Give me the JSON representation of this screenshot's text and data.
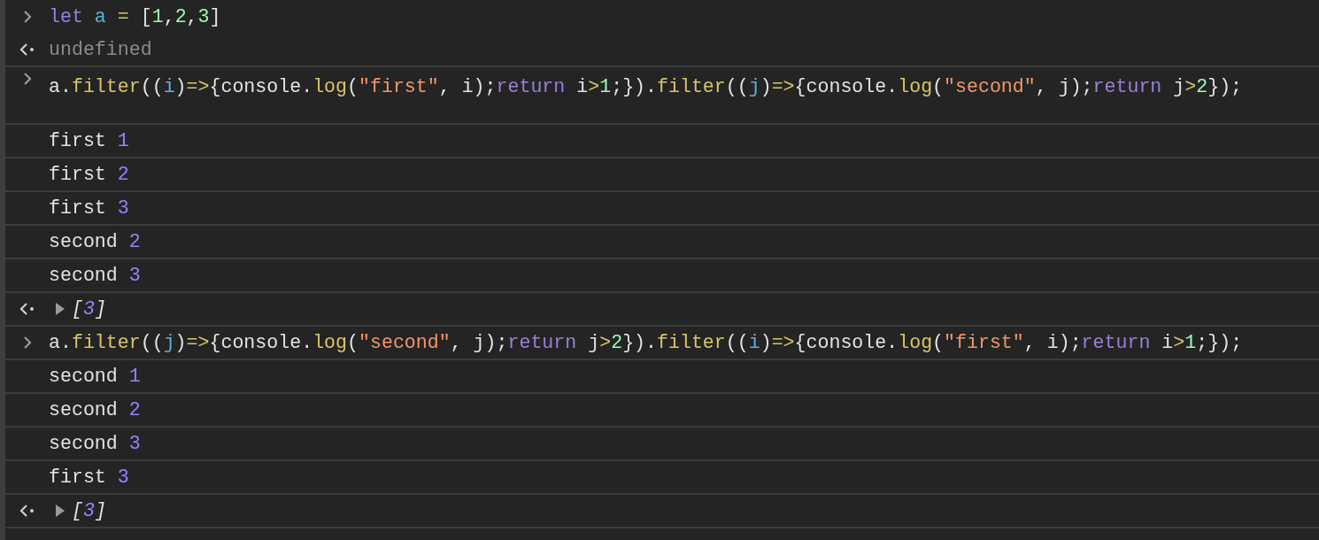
{
  "console": [
    {
      "kind": "input",
      "code": "let a = [1,2,3]"
    },
    {
      "kind": "result",
      "text": "undefined"
    },
    {
      "kind": "input",
      "tall": true,
      "code": "a.filter((i)=>{console.log(\"first\", i);return i>1;}).filter((j)=>{console.log(\"second\", j);return j>2});"
    },
    {
      "kind": "log",
      "label": "first",
      "value": "1"
    },
    {
      "kind": "log",
      "label": "first",
      "value": "2"
    },
    {
      "kind": "log",
      "label": "first",
      "value": "3"
    },
    {
      "kind": "log",
      "label": "second",
      "value": "2"
    },
    {
      "kind": "log",
      "label": "second",
      "value": "3"
    },
    {
      "kind": "array",
      "open": "[",
      "value": "3",
      "close": "]"
    },
    {
      "kind": "input",
      "code": "a.filter((j)=>{console.log(\"second\", j);return j>2}).filter((i)=>{console.log(\"first\", i);return i>1;});"
    },
    {
      "kind": "log",
      "label": "second",
      "value": "1"
    },
    {
      "kind": "log",
      "label": "second",
      "value": "2"
    },
    {
      "kind": "log",
      "label": "second",
      "value": "3"
    },
    {
      "kind": "log",
      "label": "first",
      "value": "3"
    },
    {
      "kind": "array",
      "open": "[",
      "value": "3",
      "close": "]"
    }
  ]
}
